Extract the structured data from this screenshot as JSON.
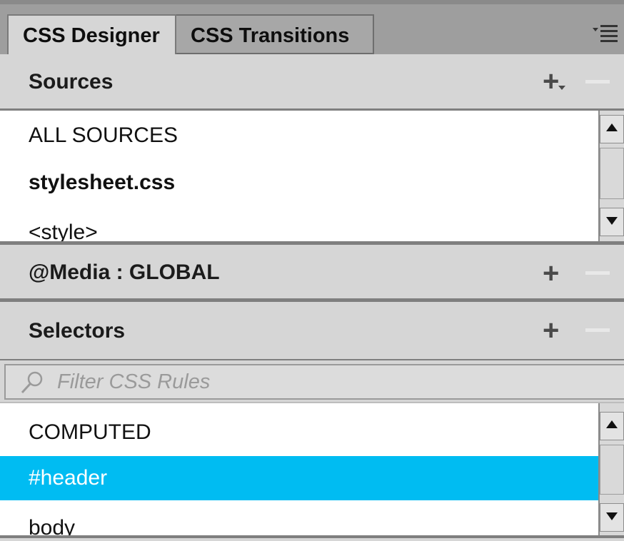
{
  "tabs": {
    "active_label": "CSS Designer",
    "inactive_label": "CSS Transitions",
    "menu_icon": "panel-menu-icon"
  },
  "sources": {
    "title": "Sources",
    "add_label": "+",
    "items": [
      "ALL SOURCES",
      "stylesheet.css",
      "<style>"
    ]
  },
  "media": {
    "title": "@Media :  GLOBAL",
    "add_label": "+"
  },
  "selectors": {
    "title": "Selectors",
    "add_label": "+",
    "filter_placeholder": "Filter CSS Rules",
    "items": [
      "COMPUTED",
      "#header",
      "body"
    ],
    "selected_item": "#header"
  },
  "colors": {
    "selection": "#00bcf2",
    "panel_bg": "#d6d6d6",
    "list_bg": "#ffffff"
  }
}
